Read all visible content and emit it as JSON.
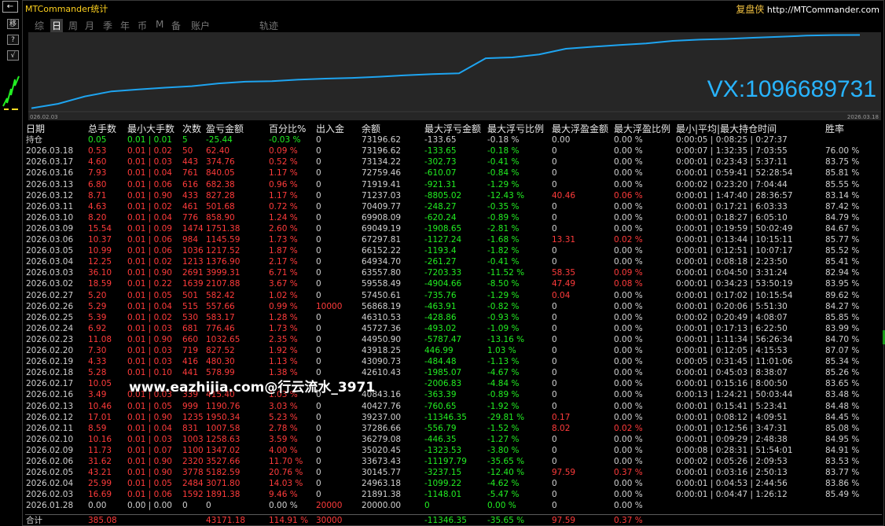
{
  "window": {
    "title": "MTCommander统计",
    "brand_cn": "复盘侠",
    "brand_url": "http://MTCommander.com",
    "corner_label": "←"
  },
  "left_buttons": [
    "移",
    "?",
    "√"
  ],
  "tabs": [
    "综",
    "日",
    "周",
    "月",
    "季",
    "年",
    "币",
    "M",
    "备",
    "账户",
    "轨迹"
  ],
  "active_tab": "日",
  "chart": {
    "date_start": "026.02.03",
    "date_end": "2026.03.18",
    "contact": "VX:1096689731",
    "line_color": "#1ea4f0",
    "background": "#262626"
  },
  "chart_data": {
    "type": "line",
    "x": [
      "2026.02.03",
      "2026.02.04",
      "2026.02.05",
      "2026.02.06",
      "2026.02.09",
      "2026.02.10",
      "2026.02.11",
      "2026.02.12",
      "2026.02.13",
      "2026.02.16",
      "2026.02.17",
      "2026.02.18",
      "2026.02.19",
      "2026.02.20",
      "2026.02.23",
      "2026.02.24",
      "2026.02.25",
      "2026.02.26",
      "2026.02.27",
      "2026.03.02",
      "2026.03.03",
      "2026.03.04",
      "2026.03.05",
      "2026.03.06",
      "2026.03.09",
      "2026.03.10",
      "2026.03.11",
      "2026.03.12",
      "2026.03.13",
      "2026.03.16",
      "2026.03.17",
      "2026.03.18"
    ],
    "series": [
      {
        "values": [
          21891.38,
          24963.18,
          30145.77,
          33673.43,
          35020.45,
          36279.08,
          37286.66,
          39237.0,
          40427.76,
          40843.16,
          41888.3,
          42610.43,
          43090.73,
          43918.25,
          44950.9,
          45727.36,
          46310.53,
          56868.19,
          57450.61,
          59558.49,
          63557.8,
          64934.7,
          66152.22,
          67297.81,
          69049.19,
          69908.09,
          70409.77,
          71237.03,
          71919.41,
          72759.46,
          73134.22,
          73196.62
        ]
      }
    ]
  },
  "columns": [
    "日期",
    "总手数",
    "最小大手数",
    "次数",
    "盈亏金额",
    "百分比%",
    "出入金",
    "余额",
    "最大浮亏金额",
    "最大浮亏比例",
    "最大浮盈金额",
    "最大浮盈比例",
    "最小|平均|最大持仓时间",
    "胜率"
  ],
  "holding": [
    "持仓",
    "0.05",
    "0.01 | 0.01",
    "5",
    "-25.44",
    "-0.03 %",
    "0",
    "73196.62",
    "-133.65",
    "-0.18 %",
    "0.00",
    "0.00 %",
    "0:00:05 | 0:08:25 | 0:27:37",
    ""
  ],
  "rows": [
    [
      "2026.03.18",
      "0.53",
      "0.01 | 0.02",
      "50",
      "62.40",
      "0.09 %",
      "0",
      "73196.62",
      "-133.65",
      "-0.18 %",
      "0",
      "0.00 %",
      "0:00:07 | 1:32:35 | 7:03:55",
      "76.00 %"
    ],
    [
      "2026.03.17",
      "4.60",
      "0.01 | 0.03",
      "443",
      "374.76",
      "0.52 %",
      "0",
      "73134.22",
      "-302.73",
      "-0.41 %",
      "0",
      "0.00 %",
      "0:00:01 | 0:23:43 | 5:37:11",
      "83.75 %"
    ],
    [
      "2026.03.16",
      "7.93",
      "0.01 | 0.04",
      "761",
      "840.05",
      "1.17 %",
      "0",
      "72759.46",
      "-610.07",
      "-0.84 %",
      "0",
      "0.00 %",
      "0:00:01 | 0:59:41 | 52:28:54",
      "85.81 %"
    ],
    [
      "2026.03.13",
      "6.80",
      "0.01 | 0.06",
      "616",
      "682.38",
      "0.96 %",
      "0",
      "71919.41",
      "-921.31",
      "-1.29 %",
      "0",
      "0.00 %",
      "0:00:02 | 0:23:20 | 7:04:44",
      "85.55 %"
    ],
    [
      "2026.03.12",
      "8.71",
      "0.01 | 0.90",
      "433",
      "827.28",
      "1.17 %",
      "0",
      "71237.03",
      "-8805.02",
      "-12.43 %",
      "40.46",
      "0.06 %",
      "0:00:01 | 1:47:40 | 28:36:57",
      "83.14 %"
    ],
    [
      "2026.03.11",
      "4.63",
      "0.01 | 0.02",
      "461",
      "501.68",
      "0.72 %",
      "0",
      "70409.77",
      "-248.27",
      "-0.35 %",
      "0",
      "0.00 %",
      "0:00:01 | 0:17:21 | 6:03:33",
      "87.42 %"
    ],
    [
      "2026.03.10",
      "8.20",
      "0.01 | 0.04",
      "776",
      "858.90",
      "1.24 %",
      "0",
      "69908.09",
      "-620.24",
      "-0.89 %",
      "0",
      "0.00 %",
      "0:00:01 | 0:18:27 | 6:05:10",
      "84.79 %"
    ],
    [
      "2026.03.09",
      "15.54",
      "0.01 | 0.09",
      "1474",
      "1751.38",
      "2.60 %",
      "0",
      "69049.19",
      "-1908.65",
      "-2.81 %",
      "0",
      "0.00 %",
      "0:00:01 | 0:19:59 | 50:02:49",
      "84.67 %"
    ],
    [
      "2026.03.06",
      "10.37",
      "0.01 | 0.06",
      "984",
      "1145.59",
      "1.73 %",
      "0",
      "67297.81",
      "-1127.24",
      "-1.68 %",
      "13.31",
      "0.02 %",
      "0:00:01 | 0:13:44 | 10:15:11",
      "85.77 %"
    ],
    [
      "2026.03.05",
      "10.99",
      "0.01 | 0.06",
      "1036",
      "1217.52",
      "1.87 %",
      "0",
      "66152.22",
      "-1193.4",
      "-1.82 %",
      "0",
      "0.00 %",
      "0:00:01 | 0:12:51 | 10:07:17",
      "85.52 %"
    ],
    [
      "2026.03.04",
      "12.25",
      "0.01 | 0.02",
      "1213",
      "1376.90",
      "2.17 %",
      "0",
      "64934.70",
      "-261.27",
      "-0.41 %",
      "0",
      "0.00 %",
      "0:00:01 | 0:08:18 | 2:23:50",
      "85.41 %"
    ],
    [
      "2026.03.03",
      "36.10",
      "0.01 | 0.90",
      "2691",
      "3999.31",
      "6.71 %",
      "0",
      "63557.80",
      "-7203.33",
      "-11.52 %",
      "58.35",
      "0.09 %",
      "0:00:01 | 0:04:50 | 3:31:24",
      "82.94 %"
    ],
    [
      "2026.03.02",
      "18.59",
      "0.01 | 0.22",
      "1639",
      "2107.88",
      "3.67 %",
      "0",
      "59558.49",
      "-4904.66",
      "-8.50 %",
      "47.49",
      "0.08 %",
      "0:00:01 | 0:34:23 | 53:50:19",
      "83.95 %"
    ],
    [
      "2026.02.27",
      "5.20",
      "0.01 | 0.05",
      "501",
      "582.42",
      "1.02 %",
      "0",
      "57450.61",
      "-735.76",
      "-1.29 %",
      "0.04",
      "0.00 %",
      "0:00:01 | 0:17:02 | 10:15:54",
      "89.62 %"
    ],
    [
      "2026.02.26",
      "5.29",
      "0.01 | 0.04",
      "515",
      "557.66",
      "0.99 %",
      "10000",
      "56868.19",
      "-463.91",
      "-0.82 %",
      "0",
      "0.00 %",
      "0:00:01 | 0:20:06 | 5:51:30",
      "84.27 %"
    ],
    [
      "2026.02.25",
      "5.39",
      "0.01 | 0.02",
      "530",
      "583.17",
      "1.28 %",
      "0",
      "46310.53",
      "-428.86",
      "-0.93 %",
      "0",
      "0.00 %",
      "0:00:02 | 0:20:49 | 4:08:07",
      "85.85 %"
    ],
    [
      "2026.02.24",
      "6.92",
      "0.01 | 0.03",
      "681",
      "776.46",
      "1.73 %",
      "0",
      "45727.36",
      "-493.02",
      "-1.09 %",
      "0",
      "0.00 %",
      "0:00:01 | 0:17:13 | 6:22:50",
      "83.99 %"
    ],
    [
      "2026.02.23",
      "11.08",
      "0.01 | 0.90",
      "660",
      "1032.65",
      "2.35 %",
      "0",
      "44950.90",
      "-5787.47",
      "-13.16 %",
      "0",
      "0.00 %",
      "0:00:01 | 1:11:34 | 56:26:34",
      "84.70 %"
    ],
    [
      "2026.02.20",
      "7.30",
      "0.01 | 0.03",
      "719",
      "827.52",
      "1.92 %",
      "0",
      "43918.25",
      "446.99",
      "1.03 %",
      "0",
      "0.00 %",
      "0:00:01 | 0:12:05 | 4:15:53",
      "87.07 %"
    ],
    [
      "2026.02.19",
      "4.33",
      "0.01 | 0.03",
      "416",
      "480.30",
      "1.13 %",
      "0",
      "43090.73",
      "-484.48",
      "-1.13 %",
      "0",
      "0.00 %",
      "0:00:05 | 0:31:45 | 11:01:06",
      "85.34 %"
    ],
    [
      "2026.02.18",
      "5.28",
      "0.01 | 0.10",
      "441",
      "578.99",
      "1.38 %",
      "0",
      "42610.43",
      "-1985.07",
      "-4.67 %",
      "0",
      "0.00 %",
      "0:00:01 | 0:45:03 | 8:38:07",
      "85.26 %"
    ],
    [
      "2026.02.17",
      "10.05",
      "",
      "",
      "",
      "",
      "",
      "",
      "-2006.83",
      "-4.84 %",
      "0",
      "0.00 %",
      "0:00:01 | 0:15:16 | 8:00:50",
      "83.65 %"
    ],
    [
      "2026.02.16",
      "3.49",
      "0.01 | 0.03",
      "339",
      "415.40",
      "1.03 %",
      "0",
      "40843.16",
      "-363.39",
      "-0.89 %",
      "0",
      "0.00 %",
      "0:00:13 | 1:24:21 | 50:03:44",
      "83.48 %"
    ],
    [
      "2026.02.13",
      "10.46",
      "0.01 | 0.05",
      "999",
      "1190.76",
      "3.03 %",
      "0",
      "40427.76",
      "-760.65",
      "-1.92 %",
      "0",
      "0.00 %",
      "0:00:01 | 0:15:41 | 5:23:41",
      "84.48 %"
    ],
    [
      "2026.02.12",
      "17.01",
      "0.01 | 0.90",
      "1235",
      "1950.34",
      "5.23 %",
      "0",
      "39237.00",
      "-11346.35",
      "-29.81 %",
      "0.17",
      "0.00 %",
      "0:00:01 | 0:08:12 | 4:09:51",
      "84.45 %"
    ],
    [
      "2026.02.11",
      "8.59",
      "0.01 | 0.04",
      "831",
      "1007.58",
      "2.78 %",
      "0",
      "37286.66",
      "-556.79",
      "-1.52 %",
      "8.02",
      "0.02 %",
      "0:00:01 | 0:12:56 | 3:47:31",
      "85.08 %"
    ],
    [
      "2026.02.10",
      "10.16",
      "0.01 | 0.03",
      "1003",
      "1258.63",
      "3.59 %",
      "0",
      "36279.08",
      "-446.35",
      "-1.27 %",
      "0",
      "0.00 %",
      "0:00:01 | 0:09:29 | 2:48:38",
      "84.95 %"
    ],
    [
      "2026.02.09",
      "11.73",
      "0.01 | 0.07",
      "1100",
      "1347.02",
      "4.00 %",
      "0",
      "35020.45",
      "-1323.53",
      "-3.80 %",
      "0",
      "0.00 %",
      "0:00:08 | 0:28:31 | 51:54:01",
      "84.91 %"
    ],
    [
      "2026.02.06",
      "31.62",
      "0.01 | 0.90",
      "2320",
      "3527.66",
      "11.70 %",
      "0",
      "33673.43",
      "-11197.79",
      "-35.65 %",
      "0",
      "0.00 %",
      "0:00:02 | 0:05:26 | 2:09:53",
      "83.53 %"
    ],
    [
      "2026.02.05",
      "43.21",
      "0.01 | 0.90",
      "3778",
      "5182.59",
      "20.76 %",
      "0",
      "30145.77",
      "-3237.15",
      "-12.40 %",
      "97.59",
      "0.37 %",
      "0:00:01 | 0:03:16 | 2:50:13",
      "83.77 %"
    ],
    [
      "2026.02.04",
      "25.99",
      "0.01 | 0.05",
      "2484",
      "3071.80",
      "14.03 %",
      "0",
      "24963.18",
      "-1099.22",
      "-4.62 %",
      "0",
      "0.00 %",
      "0:00:01 | 0:04:53 | 2:44:56",
      "83.86 %"
    ],
    [
      "2026.02.03",
      "16.69",
      "0.01 | 0.06",
      "1592",
      "1891.38",
      "9.46 %",
      "0",
      "21891.38",
      "-1148.01",
      "-5.47 %",
      "0",
      "0.00 %",
      "0:00:01 | 0:04:47 | 1:26:12",
      "85.49 %"
    ],
    [
      "2026.01.28",
      "0.00",
      "0.00 | 0.00",
      "0",
      "0",
      "0.00 %",
      "20000",
      "20000.00",
      "0",
      "0.00 %",
      "0",
      "0.00 %",
      "",
      ""
    ]
  ],
  "totals": [
    "合计",
    "385.08",
    "",
    "",
    "43171.18",
    "114.91 %",
    "30000",
    "",
    "-11346.35",
    "-35.65 %",
    "97.59",
    "0.37 %",
    "",
    ""
  ],
  "watermark": "www.eazhijia.com@行云流水_3971"
}
